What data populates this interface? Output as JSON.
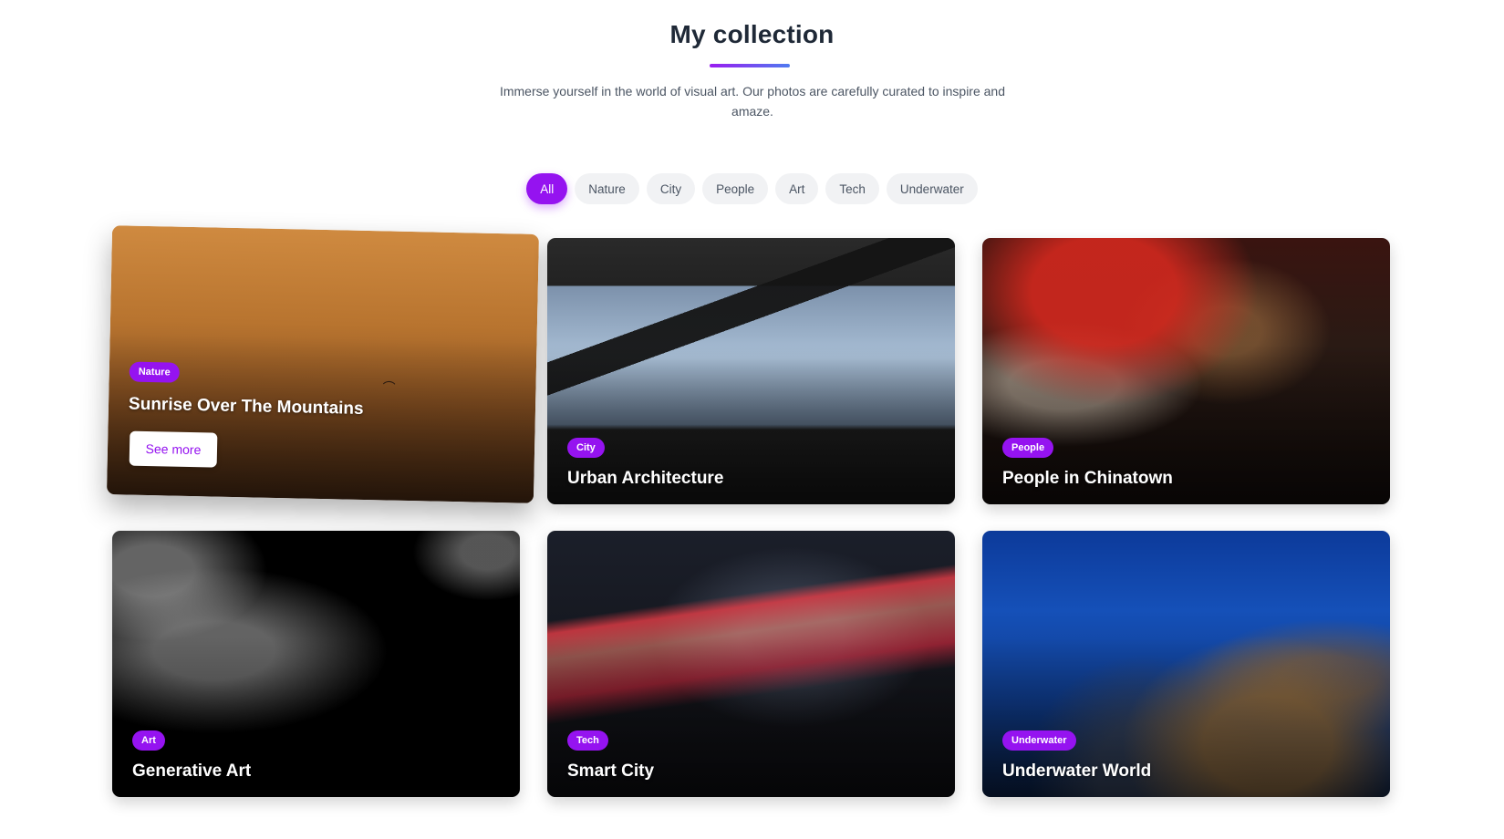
{
  "header": {
    "title": "My collection",
    "subtitle": "Immerse yourself in the world of visual art. Our photos are carefully curated to inspire and amaze."
  },
  "filters": [
    {
      "label": "All",
      "active": true
    },
    {
      "label": "Nature",
      "active": false
    },
    {
      "label": "City",
      "active": false
    },
    {
      "label": "People",
      "active": false
    },
    {
      "label": "Art",
      "active": false
    },
    {
      "label": "Tech",
      "active": false
    },
    {
      "label": "Underwater",
      "active": false
    }
  ],
  "cards": [
    {
      "tag": "Nature",
      "title": "Sunrise Over The Mountains",
      "button": "See more"
    },
    {
      "tag": "City",
      "title": "Urban Architecture"
    },
    {
      "tag": "People",
      "title": "People in Chinatown"
    },
    {
      "tag": "Art",
      "title": "Generative Art"
    },
    {
      "tag": "Tech",
      "title": "Smart City"
    },
    {
      "tag": "Underwater",
      "title": "Underwater World"
    }
  ],
  "colors": {
    "accent": "#9513f0",
    "title_text": "#1f2937",
    "body_text": "#4b5563",
    "filter_bg": "#f1f2f4"
  }
}
